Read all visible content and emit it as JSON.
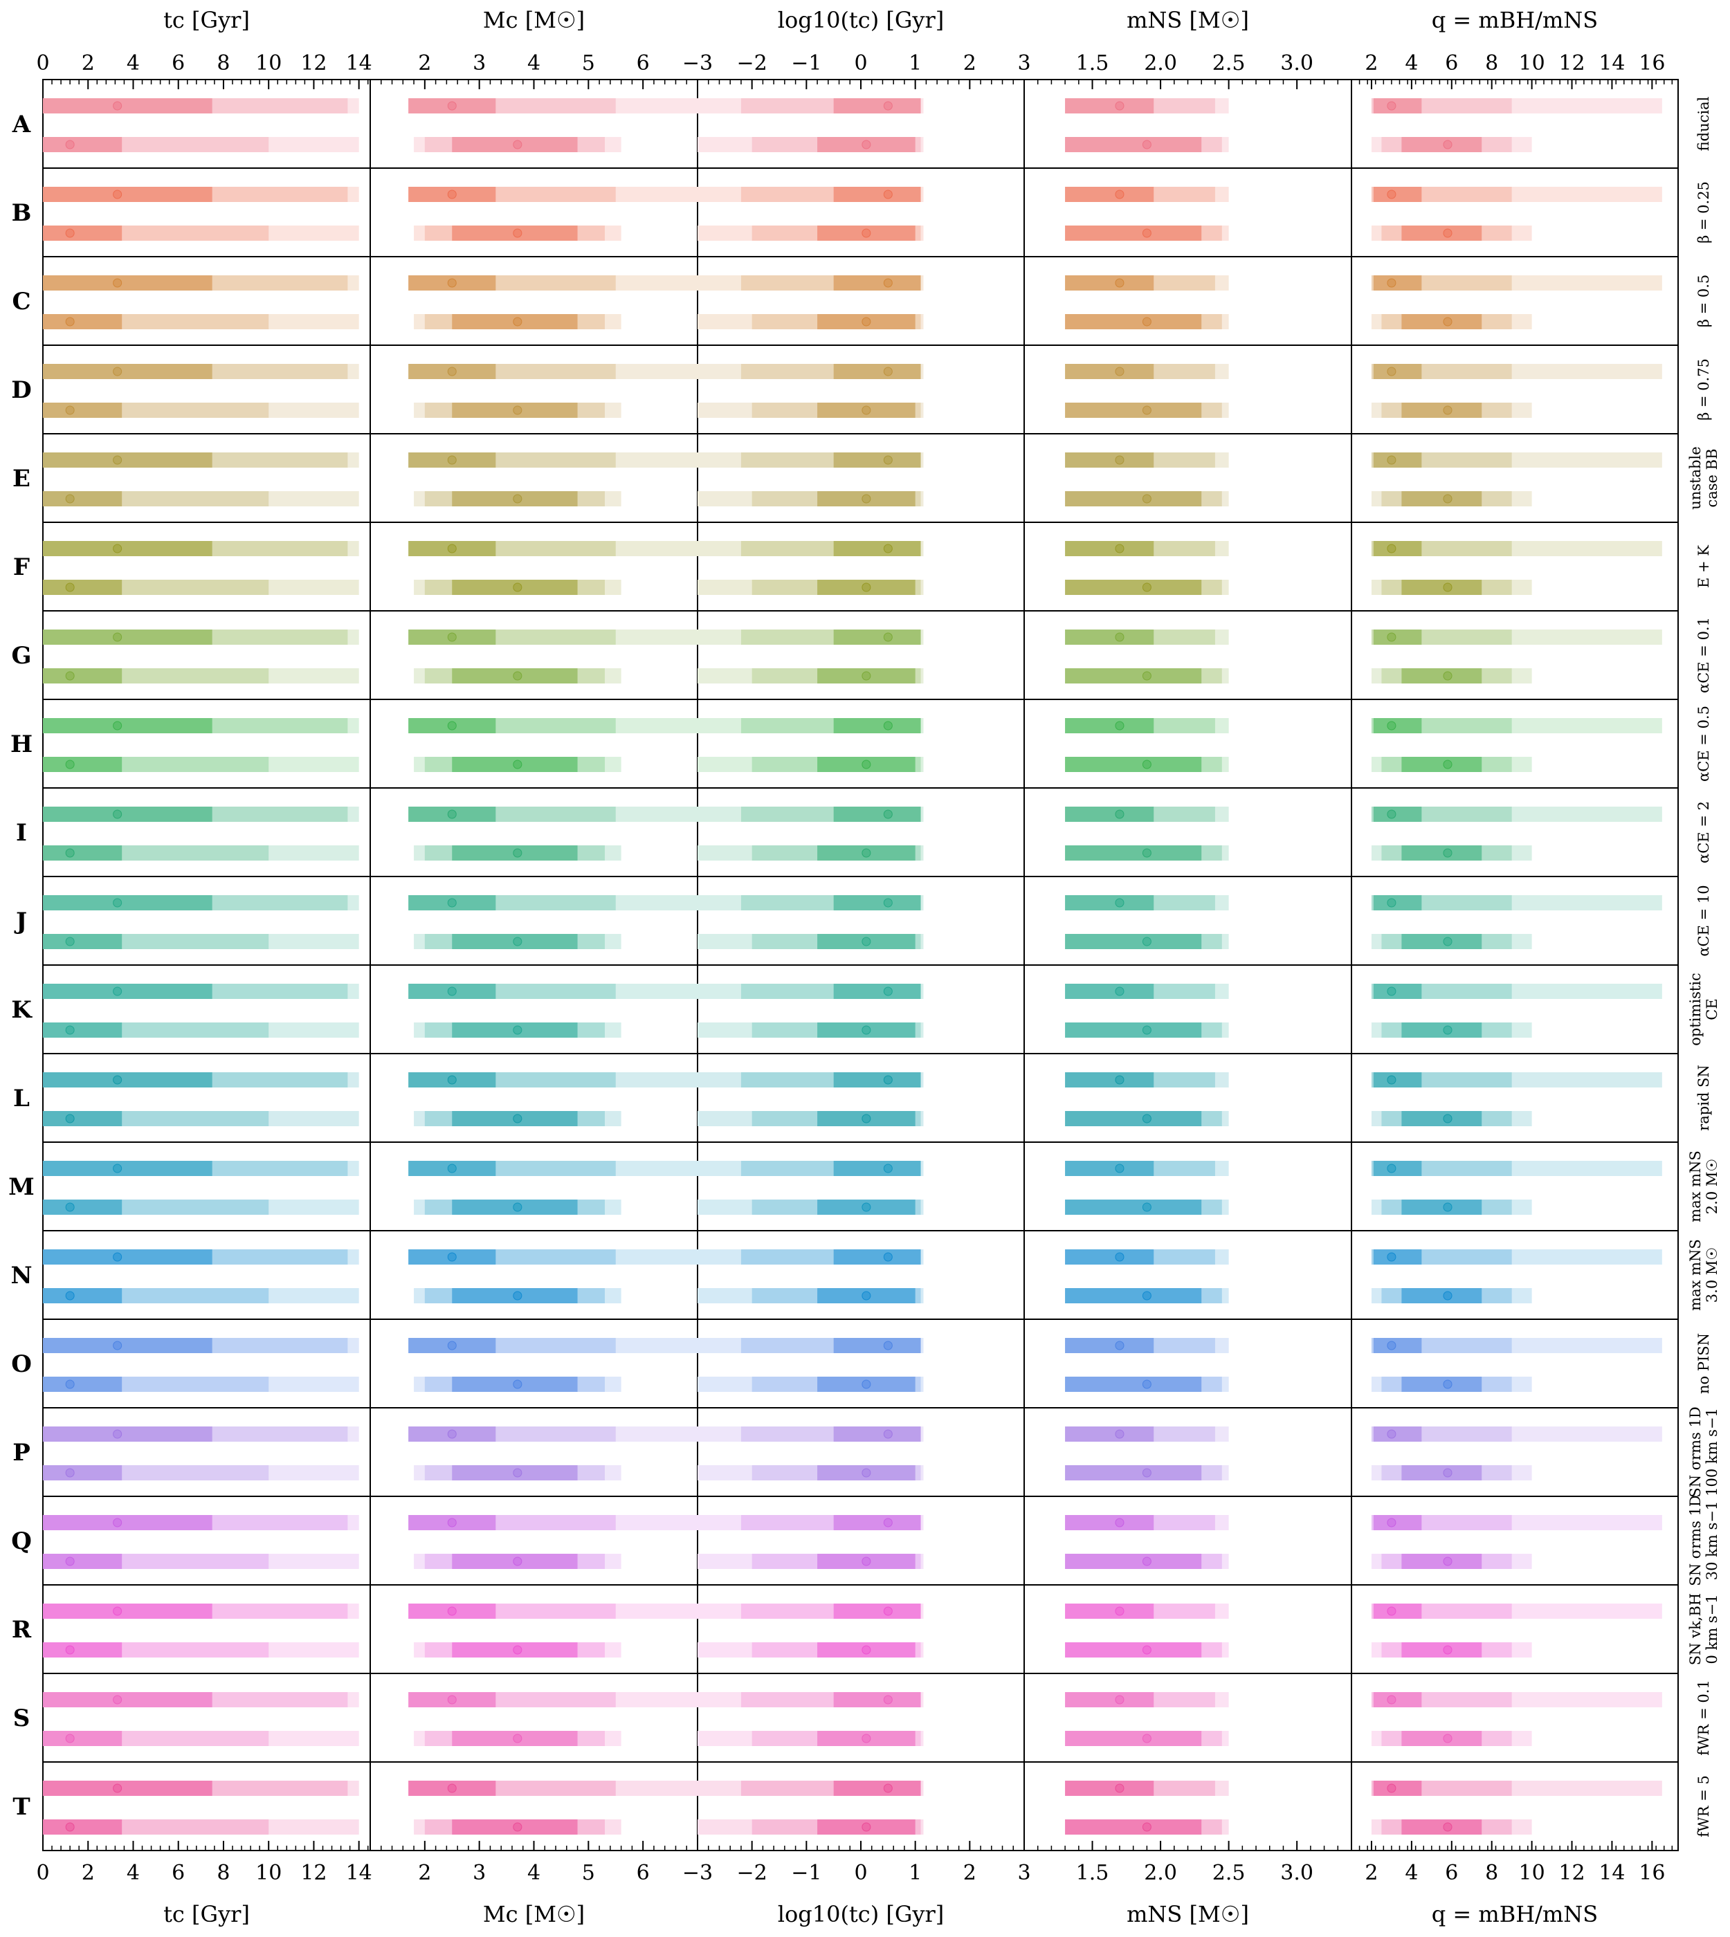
{
  "chart_data": {
    "type": "range-bars",
    "layout": "grid of 20 rows x 5 columns",
    "columns": [
      {
        "key": "tc",
        "label": "tc [Gyr]",
        "lim": [
          0,
          14.5
        ],
        "ticks": [
          0,
          2,
          4,
          6,
          8,
          10,
          12,
          14
        ],
        "tick_labels": [
          "0",
          "2",
          "4",
          "6",
          "8",
          "10",
          "12",
          "14"
        ]
      },
      {
        "key": "mc",
        "label": "Mc [M☉]",
        "lim": [
          1.0,
          7.0
        ],
        "ticks": [
          2,
          3,
          4,
          5,
          6
        ],
        "tick_labels": [
          "2",
          "3",
          "4",
          "5",
          "6"
        ]
      },
      {
        "key": "logtc",
        "label": "log10(tc) [Gyr]",
        "lim": [
          -3,
          3
        ],
        "ticks": [
          -3,
          -2,
          -1,
          0,
          1,
          2,
          3
        ],
        "tick_labels": [
          "−3",
          "−2",
          "−1",
          "0",
          "1",
          "2",
          "3"
        ]
      },
      {
        "key": "mns",
        "label": "mNS [M☉]",
        "lim": [
          1.0,
          3.4
        ],
        "ticks": [
          1.5,
          2.0,
          2.5,
          3.0
        ],
        "tick_labels": [
          "1.5",
          "2.0",
          "2.5",
          "3.0"
        ]
      },
      {
        "key": "q",
        "label": "q = mBH/mNS",
        "lim": [
          1,
          17.3
        ],
        "ticks": [
          2,
          4,
          6,
          8,
          10,
          12,
          14,
          16
        ],
        "tick_labels": [
          "2",
          "4",
          "6",
          "8",
          "10",
          "12",
          "14",
          "16"
        ]
      }
    ],
    "rows": [
      {
        "letter": "A",
        "label": [
          "fiducial"
        ],
        "color": "#f08a9a"
      },
      {
        "letter": "B",
        "label": [
          "β = 0.25"
        ],
        "color": "#f0866e"
      },
      {
        "letter": "C",
        "label": [
          "β = 0.5"
        ],
        "color": "#d99a5a"
      },
      {
        "letter": "D",
        "label": [
          "β = 0.75"
        ],
        "color": "#c9a45e"
      },
      {
        "letter": "E",
        "label": [
          "unstable",
          "case BB"
        ],
        "color": "#b9a85a"
      },
      {
        "letter": "F",
        "label": [
          "E + K"
        ],
        "color": "#a8aa4a"
      },
      {
        "letter": "G",
        "label": [
          "αCE = 0.1"
        ],
        "color": "#92b85a"
      },
      {
        "letter": "H",
        "label": [
          "αCE = 0.5"
        ],
        "color": "#5cbf6a"
      },
      {
        "letter": "I",
        "label": [
          "αCE = 2"
        ],
        "color": "#4fb88a"
      },
      {
        "letter": "J",
        "label": [
          "αCE = 10"
        ],
        "color": "#4ab79a"
      },
      {
        "letter": "K",
        "label": [
          "optimistic",
          "CE"
        ],
        "color": "#45b5a5"
      },
      {
        "letter": "L",
        "label": [
          "rapid SN"
        ],
        "color": "#3aaab5"
      },
      {
        "letter": "M",
        "label": [
          "max mNS",
          "2.0 M☉"
        ],
        "color": "#3aa7c8"
      },
      {
        "letter": "N",
        "label": [
          "max mNS",
          "3.0 M☉"
        ],
        "color": "#3a9ed8"
      },
      {
        "letter": "O",
        "label": [
          "no PISN"
        ],
        "color": "#6a98e8"
      },
      {
        "letter": "P",
        "label": [
          "SN σrms 1D",
          "100 km s−1"
        ],
        "color": "#b08ee8"
      },
      {
        "letter": "Q",
        "label": [
          "SN σrms 1D",
          "30 km s−1"
        ],
        "color": "#d07ae8"
      },
      {
        "letter": "R",
        "label": [
          "SN vk,BH",
          "0 km s−1"
        ],
        "color": "#f070d8"
      },
      {
        "letter": "S",
        "label": [
          "fWR = 0.1"
        ],
        "color": "#f07ac8"
      },
      {
        "letter": "T",
        "label": [
          "fWR = 5"
        ],
        "color": "#ee6aa8"
      }
    ],
    "note": "Each cell shows two horizontal nested credible-interval bars (50/90/99%) with median dots for the two distributions; values below are approximate readings of median and interval extents.",
    "cells": {
      "tc": {
        "top": {
          "m": 3.3,
          "i50": [
            0,
            7.5
          ],
          "i90": [
            0,
            13.5
          ],
          "i99": [
            0,
            14
          ]
        },
        "bot": {
          "m": 1.2,
          "i50": [
            0,
            3.5
          ],
          "i90": [
            0,
            10
          ],
          "i99": [
            0,
            14
          ]
        }
      },
      "mc": {
        "top": {
          "m": 2.5,
          "i50": [
            1.7,
            3.3
          ],
          "i90": [
            1.7,
            5.5
          ],
          "i99": [
            1.7,
            7.0
          ]
        },
        "bot": {
          "m": 3.7,
          "i50": [
            2.5,
            4.8
          ],
          "i90": [
            2.0,
            5.3
          ],
          "i99": [
            1.8,
            5.6
          ]
        }
      },
      "logtc": {
        "top": {
          "m": 0.5,
          "i50": [
            -0.5,
            1.1
          ],
          "i90": [
            -2.2,
            1.1
          ],
          "i99": [
            -3,
            1.15
          ]
        },
        "bot": {
          "m": 0.1,
          "i50": [
            -0.8,
            1.0
          ],
          "i90": [
            -2.0,
            1.1
          ],
          "i99": [
            -3,
            1.15
          ]
        }
      },
      "mns": {
        "top": {
          "m": 1.7,
          "i50": [
            1.3,
            1.95
          ],
          "i90": [
            1.3,
            2.4
          ],
          "i99": [
            1.3,
            2.5
          ]
        },
        "bot": {
          "m": 1.9,
          "i50": [
            1.3,
            2.3
          ],
          "i90": [
            1.3,
            2.45
          ],
          "i99": [
            1.3,
            2.5
          ]
        }
      },
      "q": {
        "top": {
          "m": 3.0,
          "i50": [
            2.1,
            4.5
          ],
          "i90": [
            2.0,
            9.0
          ],
          "i99": [
            2.0,
            16.5
          ]
        },
        "bot": {
          "m": 5.8,
          "i50": [
            3.5,
            7.5
          ],
          "i90": [
            2.5,
            9.0
          ],
          "i99": [
            2.0,
            10.0
          ]
        }
      }
    }
  }
}
